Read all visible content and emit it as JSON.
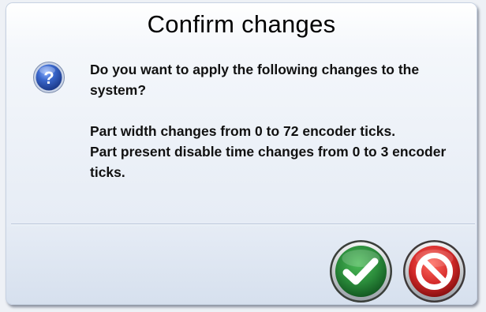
{
  "dialog": {
    "title": "Confirm changes",
    "icon": "question-mark-icon",
    "question": "Do you want to apply the following changes to the system?",
    "changes": [
      "Part width changes from 0 to 72 encoder ticks.",
      "Part present disable time changes from 0 to 3 encoder ticks."
    ]
  },
  "buttons": {
    "confirm": {
      "icon": "checkmark-icon",
      "color": "#2a8a3a"
    },
    "cancel": {
      "icon": "prohibited-icon",
      "color": "#d42a2a"
    }
  },
  "colors": {
    "dialog_background_top": "#ffffff",
    "dialog_background_bottom": "#d6e0ee",
    "help_icon_blue": "#2c56b5"
  }
}
